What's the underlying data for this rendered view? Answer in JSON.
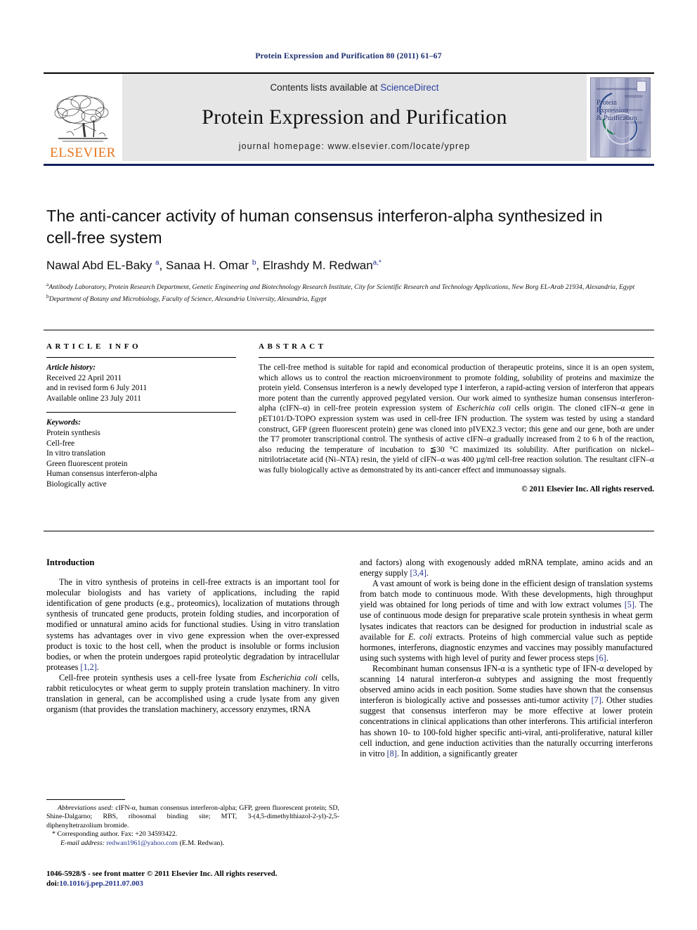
{
  "running_head": "Protein Expression and Purification 80 (2011) 61–67",
  "masthead": {
    "contents_prefix": "Contents lists available at ",
    "sciencedirect": "ScienceDirect",
    "journal_name": "Protein Expression and Purification",
    "homepage": "journal homepage: www.elsevier.com/locate/yprep",
    "elsevier_wordmark": "ELSEVIER",
    "cover_title_line1": "Protein",
    "cover_title_line2": "Expression",
    "cover_title_line3": "& Purification",
    "cover_footer": "ScienceDirect",
    "colors": {
      "elsevier_orange": "#E8731A",
      "link_blue": "#2b3f9e",
      "band_gray": "#e6e6e6",
      "rule_navy": "#13205c"
    }
  },
  "article": {
    "title": "The anti-cancer activity of human consensus interferon-alpha synthesized in cell-free system",
    "authors_html": "Nawal Abd EL-Baky <sup>a</sup>, Sanaa H. Omar <sup>b</sup>, Elrashdy M. Redwan<sup>a,*</sup>",
    "affiliations": [
      {
        "marker": "a",
        "text": "Antibody Laboratory, Protein Research Department, Genetic Engineering and Biotechnology Research Institute, City for Scientific Research and Technology Applications, New Borg EL-Arab 21934, Alexandria, Egypt"
      },
      {
        "marker": "b",
        "text": "Department of Botany and Microbiology, Faculty of Science, Alexandria University, Alexandria, Egypt"
      }
    ]
  },
  "info": {
    "heading": "ARTICLE INFO",
    "history_label": "Article history:",
    "history_lines": [
      "Received 22 April 2011",
      "and in revised form 6 July 2011",
      "Available online 23 July 2011"
    ],
    "keywords_label": "Keywords:",
    "keywords": [
      "Protein synthesis",
      "Cell-free",
      "In vitro translation",
      "Green fluorescent protein",
      "Human consensus interferon-alpha",
      "Biologically active"
    ]
  },
  "abstract": {
    "heading": "ABSTRACT",
    "text_html": "The cell-free method is suitable for rapid and economical production of therapeutic proteins, since it is an open system, which allows us to control the reaction microenvironment to promote folding, solubility of proteins and maximize the protein yield. Consensus interferon is a newly developed type I interferon, a rapid-acting version of interferon that appears more potent than the currently approved pegylated version. Our work aimed to synthesize human consensus interferon-alpha (cIFN–&#945;) in cell-free protein expression system of <i>Escherichia coli</i> cells origin. The cloned cIFN–&#945; gene in pET101/D-TOPO expression system was used in cell-free IFN production. The system was tested by using a standard construct, GFP (green fluorescent protein) gene was cloned into pIVEX2.3 vector; this gene and our gene, both are under the T7 promoter transcriptional control. The synthesis of active cIFN–&#945; gradually increased from 2 to 6 h of the reaction, also reducing the temperature of incubation to &#8806;30 &#176;C maximized its solubility. After purification on nickel–nitrilotriacetate acid (Ni–NTA) resin, the yield of cIFN–&#945; was 400 &#181;g/ml cell-free reaction solution. The resultant cIFN–&#945; was fully biologically active as demonstrated by its anti-cancer effect and immunoassay signals.",
    "copyright": "© 2011 Elsevier Inc. All rights reserved."
  },
  "body": {
    "heading": "Introduction",
    "left_paragraphs_html": [
      "The in vitro synthesis of proteins in cell-free extracts is an important tool for molecular biologists and has variety of applications, including the rapid identification of gene products (e.g., proteomics), localization of mutations through synthesis of truncated gene products, protein folding studies, and incorporation of modified or unnatural amino acids for functional studies. Using in vitro translation systems has advantages over in vivo gene expression when the over-expressed product is toxic to the host cell, when the product is insoluble or forms inclusion bodies, or when the protein undergoes rapid proteolytic degradation by intracellular proteases <span class=\"ref\">[1,2]</span>.",
      "Cell-free protein synthesis uses a cell-free lysate from <i>Escherichia coli</i> cells, rabbit reticulocytes or wheat germ to supply protein translation machinery. In vitro translation in general, can be accomplished using a crude lysate from any given organism (that provides the translation machinery, accessory enzymes, tRNA"
    ],
    "right_paragraphs_html": [
      "and factors) along with exogenously added mRNA template, amino acids and an energy supply <span class=\"ref\">[3,4]</span>.",
      "A vast amount of work is being done in the efficient design of translation systems from batch mode to continuous mode. With these developments, high throughput yield was obtained for long periods of time and with low extract volumes <span class=\"ref\">[5]</span>. The use of continuous mode design for preparative scale protein synthesis in wheat germ lysates indicates that reactors can be designed for production in industrial scale as available for <i>E. coli</i> extracts. Proteins of high commercial value such as peptide hormones, interferons, diagnostic enzymes and vaccines may possibly manufactured using such systems with high level of purity and fewer process steps <span class=\"ref\">[6]</span>.",
      "Recombinant human consensus IFN-&#945; is a synthetic type of IFN-&#945; developed by scanning 14 natural interferon-&#945; subtypes and assigning the most frequently observed amino acids in each position. Some studies have shown that the consensus interferon is biologically active and possesses anti-tumor activity <span class=\"ref\">[7]</span>. Other studies suggest that consensus interferon may be more effective at lower protein concentrations in clinical applications than other interferons. This artificial interferon has shown 10- to 100-fold higher specific anti-viral, anti-proliferative, natural killer cell induction, and gene induction activities than the naturally occurring interferons in vitro <span class=\"ref\">[8]</span>. In addition, a significantly greater"
    ]
  },
  "footnotes": {
    "abbreviations_html": "<i>Abbreviations used:</i> cIFN-&#945;, human consensus interferon-alpha; GFP, green fluorescent protein; SD, Shine-Dalgarno; RBS, ribosomal binding site; MTT, 3-(4,5-dimethylthiazol-2-yl)-2,5-diphenyltetrazolium bromide.",
    "corresponding_html": "* Corresponding author. Fax: +20 34593422.",
    "email_html": "<i>E-mail address:</i> <span class=\"link\">redwan1961@yahoo.com</span> (E.M. Redwan)."
  },
  "page_footer": {
    "line1": "1046-5928/$ - see front matter © 2011 Elsevier Inc. All rights reserved.",
    "doi_prefix": "doi:",
    "doi": "10.1016/j.pep.2011.07.003"
  }
}
